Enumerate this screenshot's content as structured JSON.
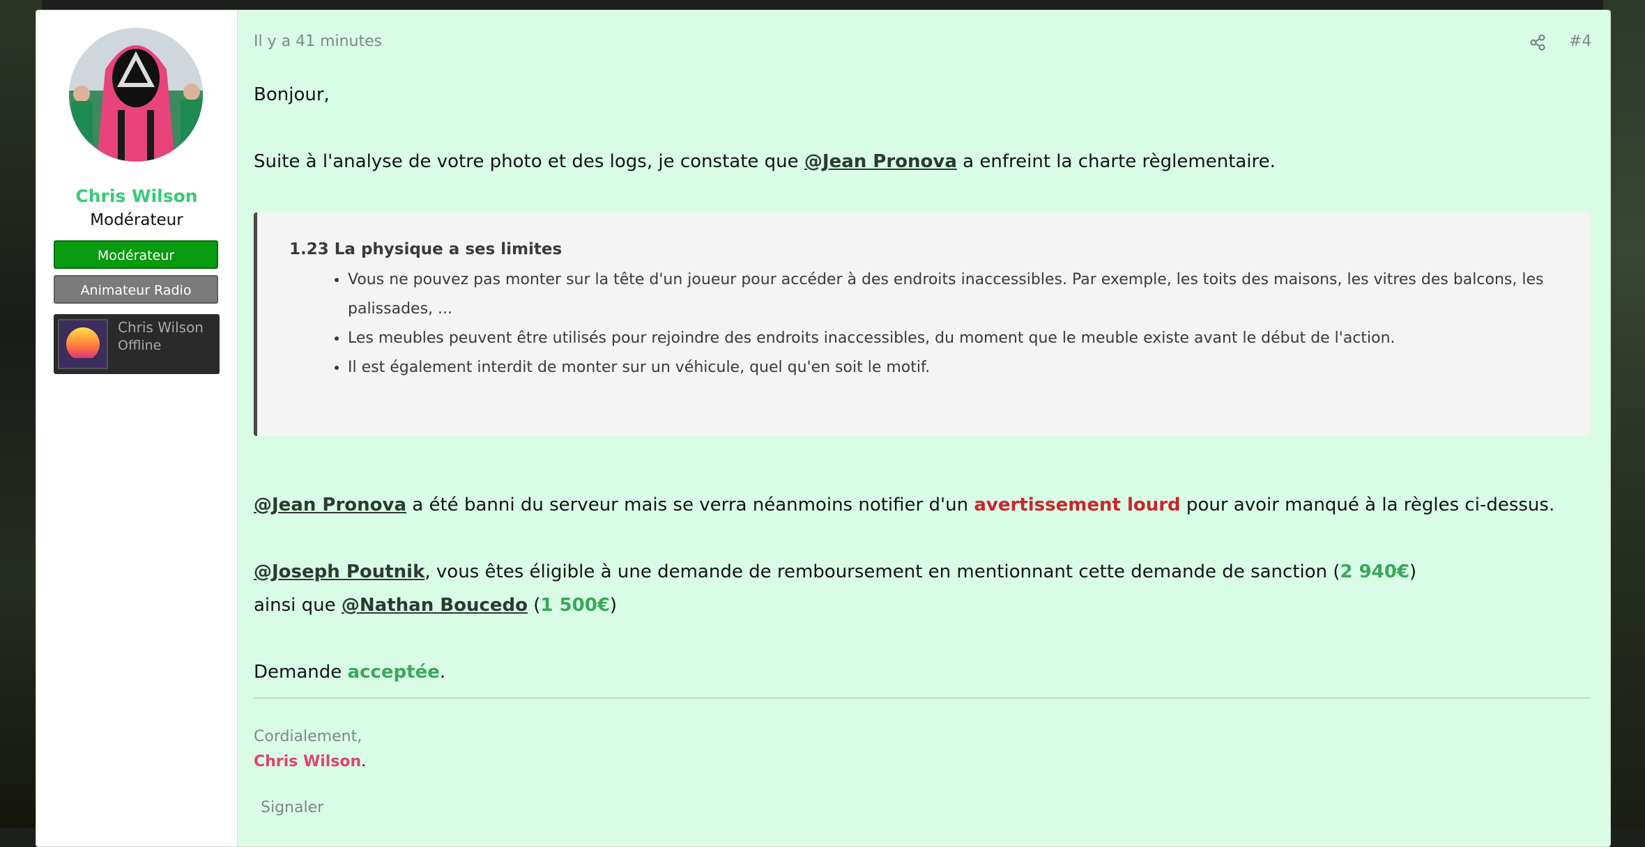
{
  "post": {
    "author": {
      "name": "Chris Wilson",
      "title": "Modérateur",
      "banners": [
        "Modérateur",
        "Animateur Radio"
      ],
      "status_card": {
        "name": "Chris Wilson",
        "state": "Offline"
      }
    },
    "meta": {
      "time": "Il y a 41 minutes",
      "post_number": "#4",
      "share_icon": "share-icon"
    },
    "body": {
      "greeting": "Bonjour,",
      "line1_before": "Suite à l'analyse de votre photo et des logs, je constate que ",
      "line1_mention": "@Jean Pronova",
      "line1_after": " a enfreint la charte règlementaire.",
      "quote": {
        "title": "1.23 La physique a ses limites",
        "items": [
          "Vous ne pouvez pas monter sur la tête d'un joueur pour accéder à des endroits inaccessibles. Par exemple, les toits des maisons, les vitres des balcons, les palissades, ...",
          "Les meubles peuvent être utilisés pour rejoindre des endroits inaccessibles, du moment que le meuble existe avant le début de l'action.",
          "Il est également interdit de monter sur un véhicule, quel qu'en soit le motif."
        ]
      },
      "ban_mention": "@Jean Pronova",
      "ban_text1": " a été banni du serveur mais se verra néanmoins notifier d'un ",
      "ban_highlight": "avertissement lourd",
      "ban_text2": " pour avoir manqué à la règles ci-dessus.",
      "refund_mention1": "@Joseph Poutnik",
      "refund_text1": ", vous êtes éligible à une demande de remboursement en mentionnant cette demande de sanction (",
      "refund_amount1": "2 940€",
      "refund_text1_end": ")",
      "refund_text2": "ainsi que ",
      "refund_mention2": "@Nathan Boucedo",
      "refund_text2_mid": " (",
      "refund_amount2": "1 500€",
      "refund_text2_end": ")",
      "decision_before": "Demande ",
      "decision_status": "acceptée",
      "decision_after": "."
    },
    "signature": {
      "line1": "Cordialement,",
      "name": "Chris Wilson",
      "suffix": "."
    },
    "actions": {
      "report_label": "Signaler"
    },
    "colors": {
      "post_background": "#d9fce7",
      "username_color": "#3cc97a",
      "warning_color": "#c8262c",
      "accepted_color": "#3aa85a",
      "signature_name_color": "#e0446c",
      "moderator_banner": "#0a9a10"
    }
  }
}
